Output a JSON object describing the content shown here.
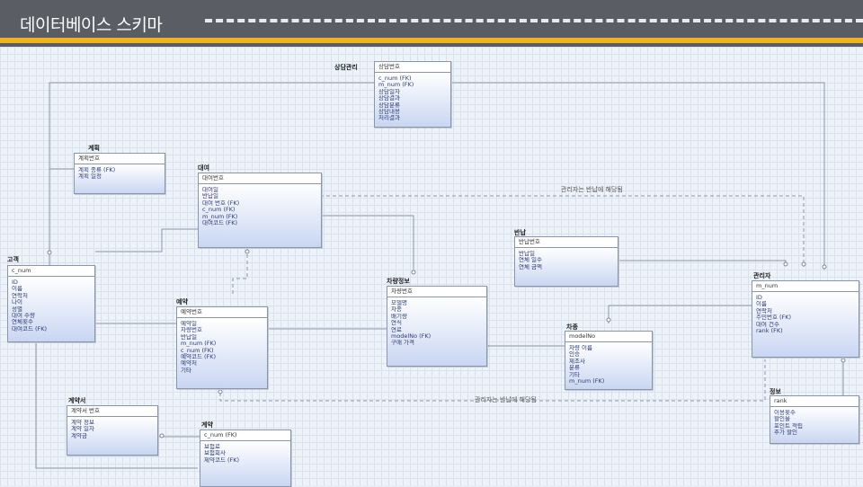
{
  "title": "데이터베이스 스키마",
  "entities": [
    {
      "id": "e1",
      "label": "상담관리",
      "pk": "상담번호",
      "attrs": [
        "c_num (FK)",
        "m_num (FK)",
        "상담일자",
        "상담결과",
        "상담분류",
        "상담내용",
        "처리결과"
      ]
    },
    {
      "id": "e2",
      "label": "계획",
      "pk": "계획번호",
      "attrs": [
        "계획 종류 (FK)",
        "계획 일정"
      ]
    },
    {
      "id": "e3",
      "label": "대여",
      "pk": "대여번호",
      "attrs": [
        "대여일",
        "반납일",
        "대여 번호 (FK)",
        "c_num (FK)",
        "m_num (FK)",
        "대여코드 (FK)"
      ]
    },
    {
      "id": "e4",
      "label": "고객",
      "pk": "c_num",
      "attrs": [
        "ID",
        "이름",
        "연락처",
        "나이",
        "성별",
        "대여 수량",
        "연체횟수",
        "대여코드 (FK)"
      ]
    },
    {
      "id": "e5",
      "label": "반납",
      "pk": "반납번호",
      "attrs": [
        "반납일",
        "연체 일수",
        "연체 금액"
      ]
    },
    {
      "id": "e6",
      "label": "예약",
      "pk": "예약번호",
      "attrs": [
        "예약일",
        "차량번호",
        "반납일",
        "m_num (FK)",
        "c_num (FK)",
        "예약코드 (FK)",
        "예약처",
        "기타"
      ]
    },
    {
      "id": "e7",
      "label": "차량정보",
      "pk": "차량번호",
      "attrs": [
        "모델명",
        "차종",
        "배기량",
        "연식",
        "연료",
        "modelNo (FK)",
        "구매 가격"
      ]
    },
    {
      "id": "e8",
      "label": "차종",
      "pk": "modelNo",
      "attrs": [
        "차량 이름",
        "인승",
        "제조사",
        "분류",
        "기타",
        "m_num (FK)"
      ]
    },
    {
      "id": "e9",
      "label": "관리자",
      "pk": "m_num",
      "attrs": [
        "ID",
        "이름",
        "연락처",
        "주민번호 (FK)",
        "대여 건수",
        "rank (FK)"
      ]
    },
    {
      "id": "e10",
      "label": "계약서",
      "pk": "계약서 번호",
      "attrs": [
        "계약 정보",
        "계약 일자",
        "계약금"
      ]
    },
    {
      "id": "e11",
      "label": "정보",
      "pk": "rank",
      "attrs": [
        "이용횟수",
        "할인율",
        "포인트 적립",
        "추가 할인"
      ]
    },
    {
      "id": "e12",
      "label": "계약",
      "pk": "c_num (FK)",
      "attrs": [
        "보험료",
        "보험회사",
        "제약코드 (FK)"
      ]
    }
  ],
  "notes": {
    "n1": "관리자는 반납에 해당됨",
    "n2": "관리자는 반납에 해당됨"
  }
}
